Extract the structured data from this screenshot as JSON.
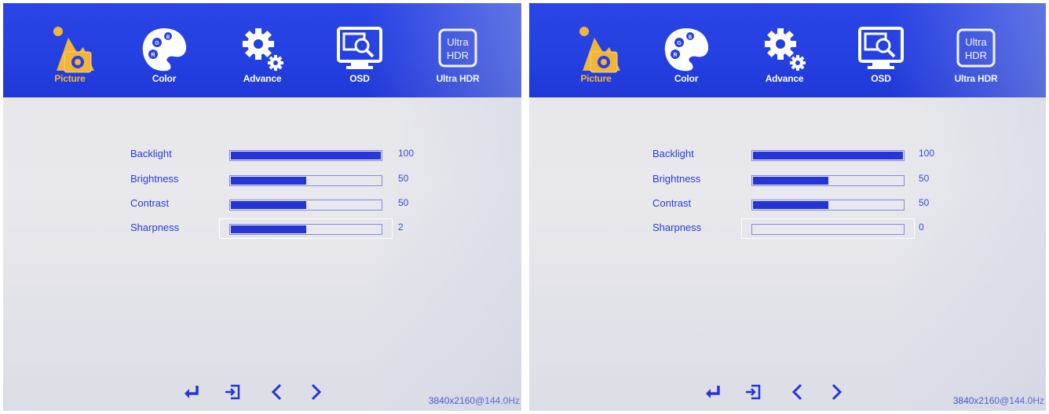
{
  "tabs": [
    {
      "label": "Picture",
      "icon": "picture-icon",
      "active": true
    },
    {
      "label": "Color",
      "icon": "color-palette-icon"
    },
    {
      "label": "Advance",
      "icon": "gear-icon"
    },
    {
      "label": "OSD",
      "icon": "osd-monitor-icon"
    },
    {
      "label": "Ultra HDR",
      "icon": "ultra-hdr-icon",
      "badge_line1": "Ultra",
      "badge_line2": "HDR"
    }
  ],
  "panels": [
    {
      "settings": [
        {
          "label": "Backlight",
          "value": "100",
          "level": 100
        },
        {
          "label": "Brightness",
          "value": "50",
          "level": 50
        },
        {
          "label": "Contrast",
          "value": "50",
          "level": 50
        },
        {
          "label": "Sharpness",
          "value": "2",
          "level": 50,
          "selected": true
        }
      ],
      "resolution": "3840x2160@144.0Hz"
    },
    {
      "settings": [
        {
          "label": "Backlight",
          "value": "100",
          "level": 100
        },
        {
          "label": "Brightness",
          "value": "50",
          "level": 50
        },
        {
          "label": "Contrast",
          "value": "50",
          "level": 50
        },
        {
          "label": "Sharpness",
          "value": "0",
          "level": 0,
          "selected": true
        }
      ],
      "resolution": "3840x2160@144.0Hz"
    }
  ],
  "footer_icons": [
    "enter-icon",
    "exit-icon",
    "chevron-left-icon",
    "chevron-right-icon"
  ],
  "colors": {
    "menu_blue": "#2440e0",
    "text_blue": "#2a3bd8",
    "active_orange": "#f2b53a"
  }
}
